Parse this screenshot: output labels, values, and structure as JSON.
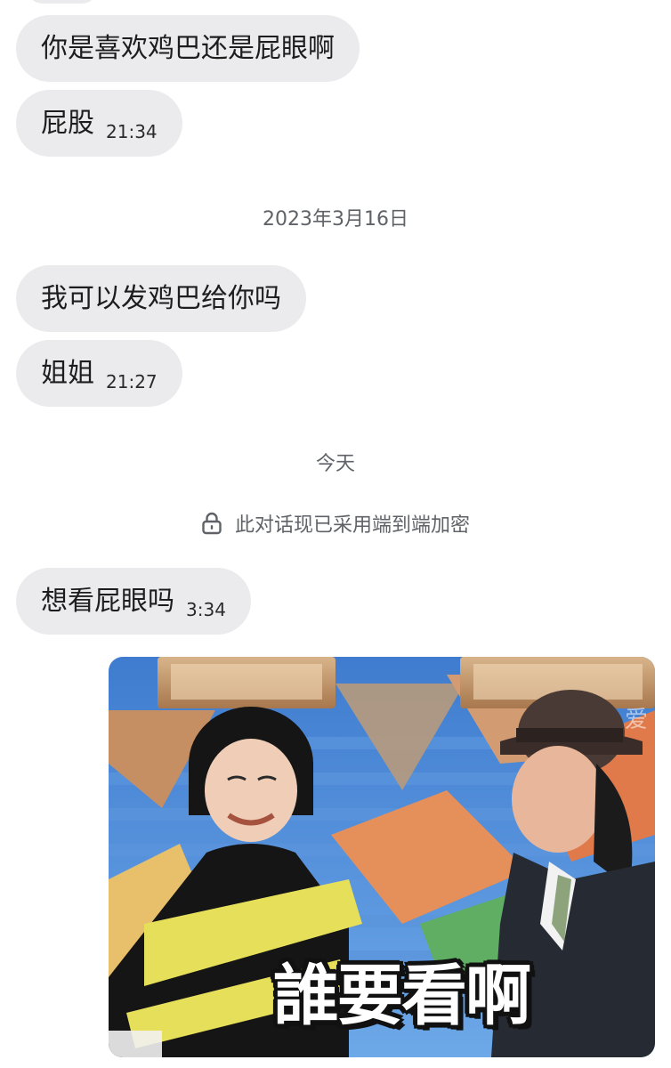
{
  "messages": [
    {
      "text": "你是喜欢鸡巴还是屁眼啊",
      "time": ""
    },
    {
      "text": "屁股",
      "time": "21:34"
    },
    {
      "text": "我可以发鸡巴给你吗",
      "time": ""
    },
    {
      "text": "姐姐",
      "time": "21:27"
    },
    {
      "text": "想看屁眼吗",
      "time": "3:34"
    }
  ],
  "dividers": {
    "date_1": "2023年3月16日",
    "today": "今天"
  },
  "encryption_notice": "此对话现已采用端到端加密",
  "sticker": {
    "caption": "誰要看啊",
    "watermark": "爱"
  },
  "icons": {
    "encryption": "lock-icon"
  },
  "colors": {
    "bubble_background": "#ebebee",
    "system_text": "#5f6368",
    "page_background": "#ffffff"
  }
}
